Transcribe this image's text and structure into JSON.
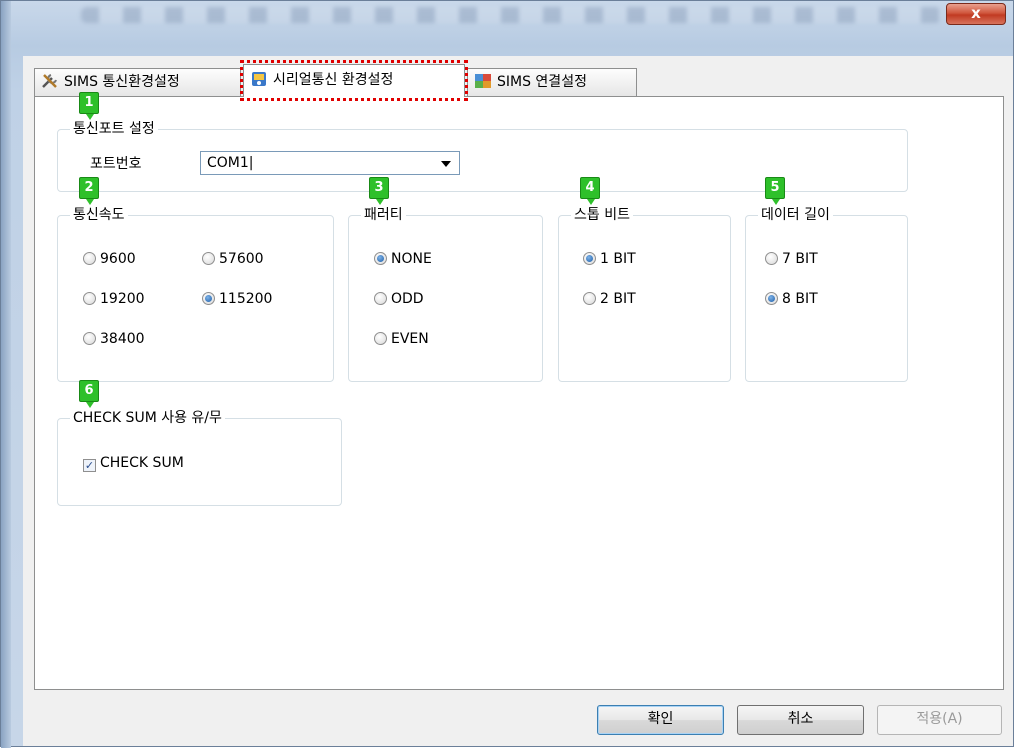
{
  "window": {
    "close_label": "x"
  },
  "tabs": [
    {
      "label": "SIMS 통신환경설정",
      "icon": "tools-icon"
    },
    {
      "label": "시리얼통신 환경설정",
      "icon": "serial-settings-icon"
    },
    {
      "label": "SIMS 연결설정",
      "icon": "connection-settings-icon"
    }
  ],
  "badges": [
    "1",
    "2",
    "3",
    "4",
    "5",
    "6"
  ],
  "port_group": {
    "title": "통신포트 설정",
    "port_label": "포트번호",
    "port_value": "COM1|"
  },
  "speed_group": {
    "title": "통신속도",
    "options": [
      "9600",
      "57600",
      "19200",
      "115200",
      "38400"
    ],
    "selected": "115200"
  },
  "parity_group": {
    "title": "패러티",
    "options": [
      "NONE",
      "ODD",
      "EVEN"
    ],
    "selected": "NONE"
  },
  "stopbit_group": {
    "title": "스톱 비트",
    "options": [
      "1 BIT",
      "2 BIT"
    ],
    "selected": "1 BIT"
  },
  "datalen_group": {
    "title": "데이터 길이",
    "options": [
      "7 BIT",
      "8 BIT"
    ],
    "selected": "8 BIT"
  },
  "checksum_group": {
    "title": "CHECK SUM 사용 유/무",
    "checkbox_label": "CHECK SUM",
    "checked": true
  },
  "buttons": {
    "ok": "확인",
    "cancel": "취소",
    "apply": "적용(A)"
  },
  "colors": {
    "badge": "#2ec02a",
    "highlight": "#e00000",
    "close_button": "#c13a22"
  }
}
